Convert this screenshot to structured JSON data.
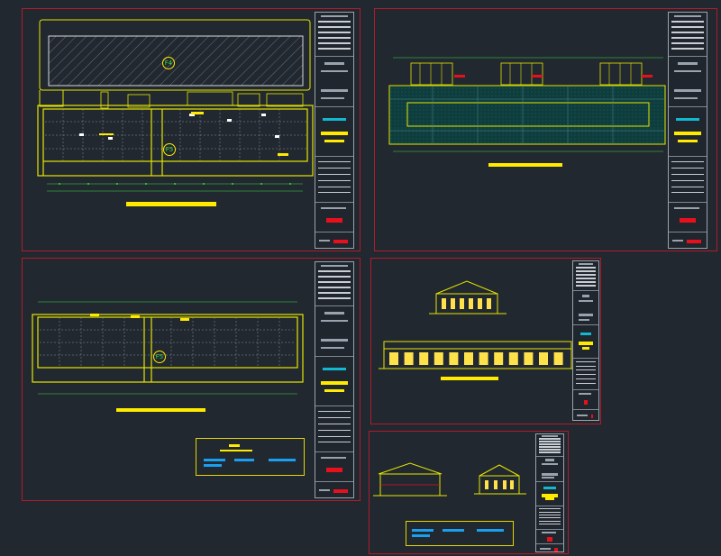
{
  "canvas": {
    "background": "#212830",
    "frame_color": "#b01c2a",
    "line_color": "#e6e600",
    "grid_color": "#9aa3ad"
  },
  "sheets": [
    {
      "id": "ground-floor-plan",
      "markers": [
        "F4",
        "F5"
      ]
    },
    {
      "id": "roof-plan",
      "markers": []
    },
    {
      "id": "upper-floor-plan",
      "markers": [
        "F5"
      ]
    },
    {
      "id": "elevations",
      "markers": []
    },
    {
      "id": "sections",
      "markers": []
    }
  ],
  "markers": {
    "a": "F4",
    "b": "F5",
    "c": "F5"
  }
}
